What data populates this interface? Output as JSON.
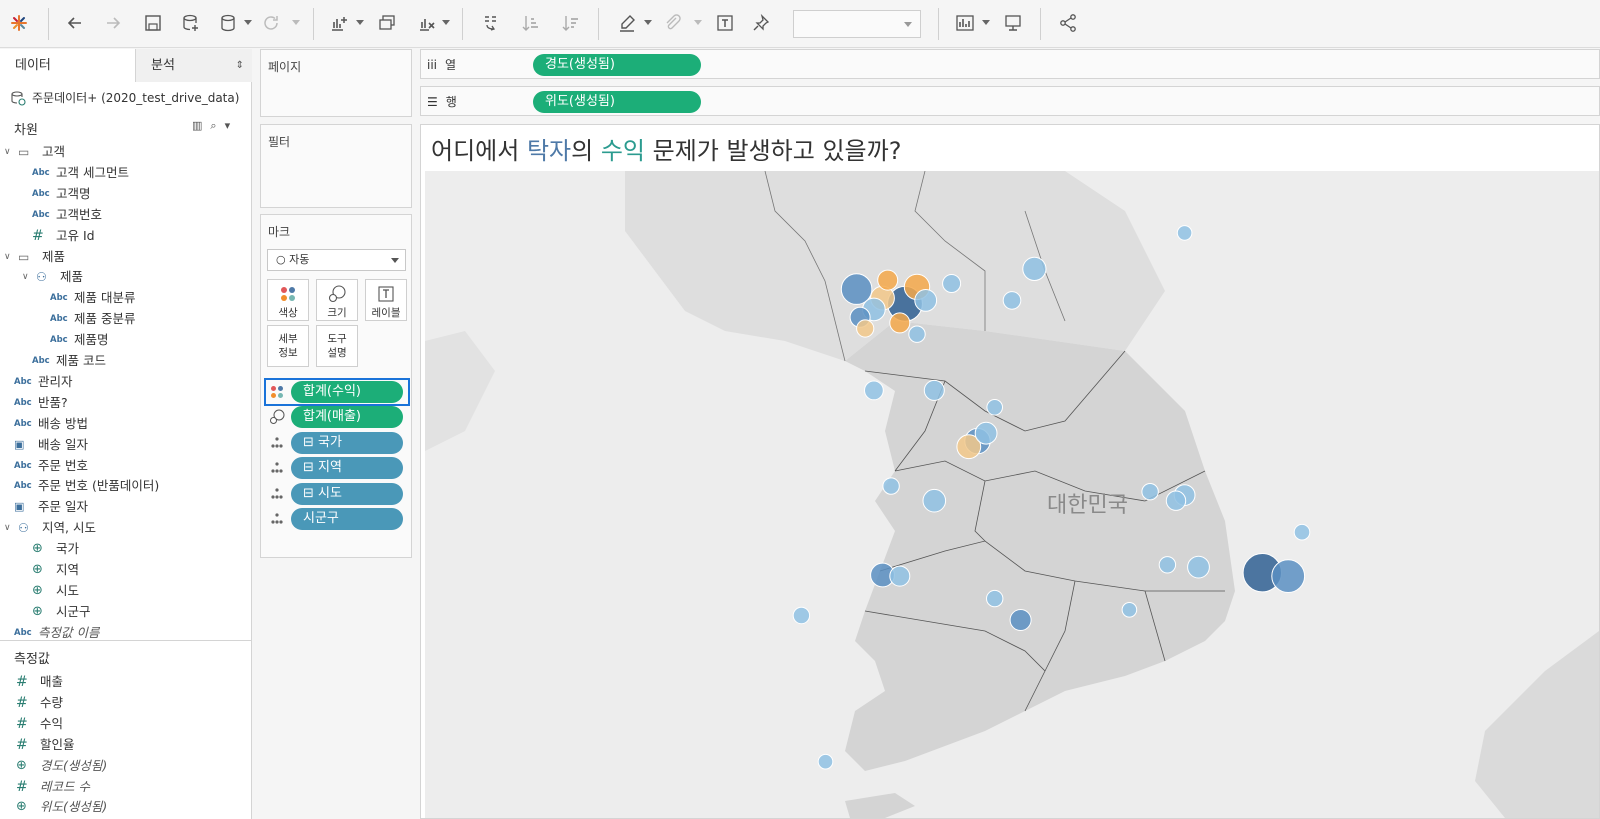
{
  "toolbar": {
    "icons": [
      "tableau-logo-icon",
      "undo-icon",
      "redo-icon",
      "save-icon",
      "new-datasource-icon",
      "pause-update-icon",
      "refresh-icon",
      "new-sheet-icon",
      "duplicate-sheet-icon",
      "clear-sheet-icon",
      "swap-axes-icon",
      "sort-ascending-icon",
      "sort-descending-icon",
      "highlight-icon",
      "group-icon",
      "label-icon",
      "pin-icon",
      "show-me-icon",
      "presentation-icon",
      "share-icon"
    ],
    "fit_dropdown_value": ""
  },
  "data_pane": {
    "tab_data": "데이터",
    "tab_analysis": "분석",
    "datasource": "주문데이터+ (2020_test_drive_data)",
    "dimensions_header": "차원",
    "measures_header": "측정값",
    "dimensions": [
      {
        "label": "고객",
        "icon": "folder",
        "level": 0,
        "expanded": true
      },
      {
        "label": "고객 세그먼트",
        "icon": "abc",
        "level": 1
      },
      {
        "label": "고객명",
        "icon": "abc",
        "level": 1
      },
      {
        "label": "고객번호",
        "icon": "abc",
        "level": 1
      },
      {
        "label": "고유 Id",
        "icon": "hash",
        "level": 1
      },
      {
        "label": "제품",
        "icon": "folder",
        "level": 0,
        "expanded": true
      },
      {
        "label": "제품",
        "icon": "hierarchy",
        "level": 1,
        "expanded": true
      },
      {
        "label": "제품 대분류",
        "icon": "abc",
        "level": 2
      },
      {
        "label": "제품 중분류",
        "icon": "abc",
        "level": 2
      },
      {
        "label": "제품명",
        "icon": "abc",
        "level": 2
      },
      {
        "label": "제품 코드",
        "icon": "abc",
        "level": 1
      },
      {
        "label": "관리자",
        "icon": "abc",
        "level": 0
      },
      {
        "label": "반품?",
        "icon": "abc",
        "level": 0
      },
      {
        "label": "배송 방법",
        "icon": "abc",
        "level": 0
      },
      {
        "label": "배송 일자",
        "icon": "calendar",
        "level": 0
      },
      {
        "label": "주문 번호",
        "icon": "abc",
        "level": 0
      },
      {
        "label": "주문 번호 (반품데이터)",
        "icon": "abc",
        "level": 0
      },
      {
        "label": "주문 일자",
        "icon": "calendar",
        "level": 0
      },
      {
        "label": "지역, 시도",
        "icon": "hierarchy",
        "level": 0,
        "expanded": true
      },
      {
        "label": "국가",
        "icon": "globe",
        "level": 1
      },
      {
        "label": "지역",
        "icon": "globe",
        "level": 1
      },
      {
        "label": "시도",
        "icon": "globe",
        "level": 1
      },
      {
        "label": "시군구",
        "icon": "globe",
        "level": 1
      },
      {
        "label": "측정값 이름",
        "icon": "abc",
        "level": 0,
        "italic": true
      }
    ],
    "measures": [
      {
        "label": "매출",
        "icon": "hash"
      },
      {
        "label": "수량",
        "icon": "hash"
      },
      {
        "label": "수익",
        "icon": "hash"
      },
      {
        "label": "할인율",
        "icon": "hash"
      },
      {
        "label": "경도(생성됨)",
        "icon": "globe",
        "italic": true
      },
      {
        "label": "레코드 수",
        "icon": "hash",
        "italic": true
      },
      {
        "label": "위도(생성됨)",
        "icon": "globe",
        "italic": true
      }
    ]
  },
  "shelves": {
    "pages": "페이지",
    "filters": "필터",
    "columns_label": "열",
    "rows_label": "행",
    "columns_pill": "경도(생성됨)",
    "rows_pill": "위도(생성됨)"
  },
  "marks": {
    "title": "마크",
    "type": "자동",
    "buttons": {
      "color": "색상",
      "size": "크기",
      "label": "레이블",
      "detail": "세부\n정보",
      "tooltip": "도구\n설명"
    },
    "pills": [
      {
        "label": "합계(수익)",
        "kind": "color",
        "style": "green",
        "selected": true
      },
      {
        "label": "합계(매출)",
        "kind": "size",
        "style": "green"
      },
      {
        "label": "⊟ 국가",
        "kind": "detail",
        "style": "blue"
      },
      {
        "label": "⊟ 지역",
        "kind": "detail",
        "style": "blue"
      },
      {
        "label": "⊟ 시도",
        "kind": "detail",
        "style": "blue"
      },
      {
        "label": "시군구",
        "kind": "detail",
        "style": "blue"
      }
    ]
  },
  "view": {
    "title_parts": [
      {
        "text": "어디에서 ",
        "style": "plain"
      },
      {
        "text": "탁자",
        "style": "hl1"
      },
      {
        "text": "의 ",
        "style": "plain"
      },
      {
        "text": "수익",
        "style": "hl2"
      },
      {
        "text": " 문제가 발생하고 있을까?",
        "style": "plain"
      }
    ],
    "country_label": "대한민국"
  },
  "colors": {
    "green_pill": "#1cae78",
    "blue_pill": "#4a98b8",
    "selection": "#1a73d9",
    "profit_dark_blue": "#2f5f92",
    "profit_mid_blue": "#5a8fc2",
    "profit_light_blue": "#8fc1e3",
    "profit_orange": "#f5a84a",
    "profit_light_orange": "#f2c889"
  },
  "map_points": [
    {
      "lon": 126.98,
      "lat": 37.57,
      "size": 900,
      "color": "#2f5f92"
    },
    {
      "lon": 126.85,
      "lat": 37.62,
      "size": 420,
      "color": "#f2c889"
    },
    {
      "lon": 126.7,
      "lat": 37.7,
      "size": 700,
      "color": "#5a8fc2"
    },
    {
      "lon": 127.05,
      "lat": 37.72,
      "size": 480,
      "color": "#f5a84a"
    },
    {
      "lon": 126.88,
      "lat": 37.78,
      "size": 300,
      "color": "#f5a84a"
    },
    {
      "lon": 127.1,
      "lat": 37.6,
      "size": 350,
      "color": "#8fc1e3"
    },
    {
      "lon": 126.8,
      "lat": 37.52,
      "size": 380,
      "color": "#8fc1e3"
    },
    {
      "lon": 126.72,
      "lat": 37.45,
      "size": 300,
      "color": "#5a8fc2"
    },
    {
      "lon": 126.95,
      "lat": 37.4,
      "size": 300,
      "color": "#f5a84a"
    },
    {
      "lon": 127.05,
      "lat": 37.3,
      "size": 200,
      "color": "#8fc1e3"
    },
    {
      "lon": 126.75,
      "lat": 37.35,
      "size": 220,
      "color": "#f2c889"
    },
    {
      "lon": 127.25,
      "lat": 37.75,
      "size": 240,
      "color": "#8fc1e3"
    },
    {
      "lon": 127.6,
      "lat": 37.6,
      "size": 230,
      "color": "#8fc1e3"
    },
    {
      "lon": 127.73,
      "lat": 37.88,
      "size": 400,
      "color": "#8fc1e3"
    },
    {
      "lon": 128.6,
      "lat": 38.2,
      "size": 160,
      "color": "#8fc1e3"
    },
    {
      "lon": 127.4,
      "lat": 36.35,
      "size": 480,
      "color": "#5a8fc2"
    },
    {
      "lon": 127.35,
      "lat": 36.3,
      "size": 420,
      "color": "#f2c889"
    },
    {
      "lon": 127.45,
      "lat": 36.42,
      "size": 350,
      "color": "#8fc1e3"
    },
    {
      "lon": 126.8,
      "lat": 36.8,
      "size": 260,
      "color": "#8fc1e3"
    },
    {
      "lon": 127.15,
      "lat": 36.8,
      "size": 300,
      "color": "#8fc1e3"
    },
    {
      "lon": 127.5,
      "lat": 36.65,
      "size": 180,
      "color": "#8fc1e3"
    },
    {
      "lon": 128.6,
      "lat": 35.87,
      "size": 320,
      "color": "#8fc1e3"
    },
    {
      "lon": 128.55,
      "lat": 35.82,
      "size": 280,
      "color": "#8fc1e3"
    },
    {
      "lon": 128.4,
      "lat": 35.9,
      "size": 200,
      "color": "#8fc1e3"
    },
    {
      "lon": 129.05,
      "lat": 35.18,
      "size": 1100,
      "color": "#2f5f92"
    },
    {
      "lon": 129.2,
      "lat": 35.15,
      "size": 800,
      "color": "#5a8fc2"
    },
    {
      "lon": 129.28,
      "lat": 35.54,
      "size": 180,
      "color": "#8fc1e3"
    },
    {
      "lon": 128.68,
      "lat": 35.23,
      "size": 350,
      "color": "#8fc1e3"
    },
    {
      "lon": 128.5,
      "lat": 35.25,
      "size": 200,
      "color": "#8fc1e3"
    },
    {
      "lon": 126.85,
      "lat": 35.16,
      "size": 420,
      "color": "#5a8fc2"
    },
    {
      "lon": 126.95,
      "lat": 35.15,
      "size": 300,
      "color": "#8fc1e3"
    },
    {
      "lon": 127.15,
      "lat": 35.82,
      "size": 380,
      "color": "#8fc1e3"
    },
    {
      "lon": 126.9,
      "lat": 35.95,
      "size": 200,
      "color": "#8fc1e3"
    },
    {
      "lon": 127.65,
      "lat": 34.76,
      "size": 330,
      "color": "#5a8fc2"
    },
    {
      "lon": 127.5,
      "lat": 34.95,
      "size": 200,
      "color": "#8fc1e3"
    },
    {
      "lon": 126.38,
      "lat": 34.8,
      "size": 200,
      "color": "#8fc1e3"
    },
    {
      "lon": 126.52,
      "lat": 33.5,
      "size": 160,
      "color": "#8fc1e3"
    },
    {
      "lon": 128.28,
      "lat": 34.85,
      "size": 160,
      "color": "#8fc1e3"
    }
  ]
}
